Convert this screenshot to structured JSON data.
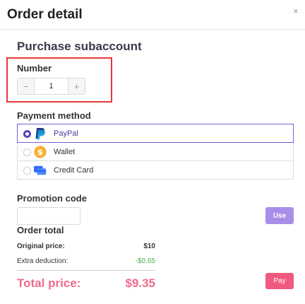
{
  "dialog": {
    "title": "Order detail",
    "close_label": "×"
  },
  "section_title": "Purchase subaccount",
  "number": {
    "label": "Number",
    "minus": "−",
    "value": "1",
    "plus": "+"
  },
  "payment": {
    "label": "Payment method",
    "options": [
      {
        "label": "PayPal",
        "icon": "paypal-icon",
        "selected": true
      },
      {
        "label": "Wallet",
        "icon": "wallet-icon",
        "selected": false
      },
      {
        "label": "Credit Card",
        "icon": "credit-card-icon",
        "selected": false
      }
    ]
  },
  "promotion": {
    "label": "Promotion code",
    "value": "",
    "use_label": "Use"
  },
  "order_total": {
    "label": "Order total",
    "original_label": "Original price:",
    "original_value": "$10",
    "extra_label": "Extra deduction:",
    "extra_value": "-$0.65",
    "total_label": "Total price:",
    "total_value": "$9.35",
    "pay_label": "Pay"
  },
  "colors": {
    "accent": "#5b3fc4",
    "total": "#f06b8b",
    "pay": "#f05a7e",
    "use": "#a98ee8",
    "highlight": "#e53935",
    "deduction": "#4caf50"
  }
}
